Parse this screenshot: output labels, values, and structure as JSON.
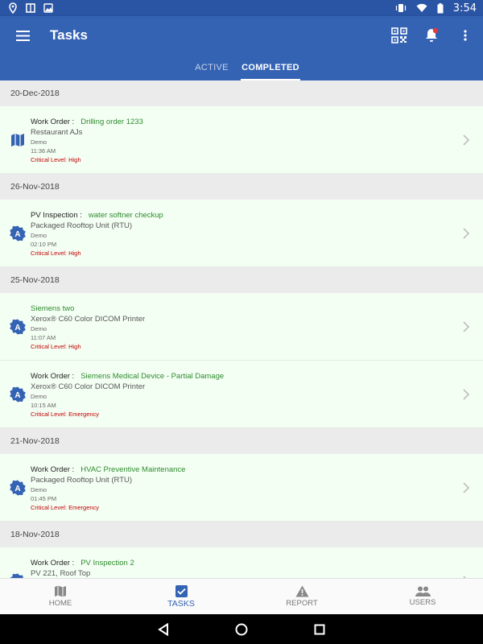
{
  "status_bar": {
    "time": "3:54"
  },
  "app_bar": {
    "title": "Tasks",
    "tabs": [
      {
        "label": "ACTIVE",
        "selected": false
      },
      {
        "label": "COMPLETED",
        "selected": true
      }
    ],
    "notification_badge_color": "#e53935"
  },
  "groups": [
    {
      "date": "20-Dec-2018",
      "items": [
        {
          "icon": "map-icon",
          "label": "Work Order :",
          "name": "Drilling order 1233",
          "asset": "Restaurant AJs",
          "site": "Demo",
          "time": "11:36 AM",
          "critical": "Critical Level: High"
        }
      ]
    },
    {
      "date": "26-Nov-2018",
      "items": [
        {
          "icon": "inspection-badge-icon",
          "label": "PV Inspection :",
          "name": "water softner checkup",
          "asset": "Packaged Rooftop Unit (RTU)",
          "site": "Demo",
          "time": "02:10 PM",
          "critical": "Critical Level: High"
        }
      ]
    },
    {
      "date": "25-Nov-2018",
      "items": [
        {
          "icon": "inspection-badge-icon",
          "label": "",
          "name": "Siemens two",
          "asset": "Xerox® C60 Color DICOM Printer",
          "site": "Demo",
          "time": "11:07 AM",
          "critical": "Critical Level: High"
        },
        {
          "icon": "inspection-badge-icon",
          "label": "Work Order :",
          "name": "Siemens Medical Device - Partial Damage",
          "asset": "Xerox® C60 Color DICOM Printer",
          "site": "Demo",
          "time": "10:15 AM",
          "critical": "Critical Level: Emergency"
        }
      ]
    },
    {
      "date": "21-Nov-2018",
      "items": [
        {
          "icon": "inspection-badge-icon",
          "label": "Work Order :",
          "name": "HVAC Preventive Maintenance",
          "asset": "Packaged Rooftop Unit (RTU)",
          "site": "Demo",
          "time": "01:45 PM",
          "critical": "Critical Level: Emergency"
        }
      ]
    },
    {
      "date": "18-Nov-2018",
      "items": [
        {
          "icon": "inspection-badge-icon",
          "label": "Work Order :",
          "name": "PV Inspection 2",
          "asset": "PV 221, Roof Top",
          "site": "",
          "time": "",
          "critical": ""
        }
      ]
    }
  ],
  "bottom_nav": [
    {
      "label": "HOME",
      "icon": "map-icon",
      "active": false
    },
    {
      "label": "TASKS",
      "icon": "checkbox-icon",
      "active": true
    },
    {
      "label": "REPORT",
      "icon": "warning-icon",
      "active": false
    },
    {
      "label": "USERS",
      "icon": "users-icon",
      "active": false
    }
  ],
  "colors": {
    "primary": "#3563b4",
    "status_bar": "#2a54a4",
    "task_name": "#2e8b2e",
    "critical": "#c00000",
    "row_bg": "#f4fff4"
  }
}
